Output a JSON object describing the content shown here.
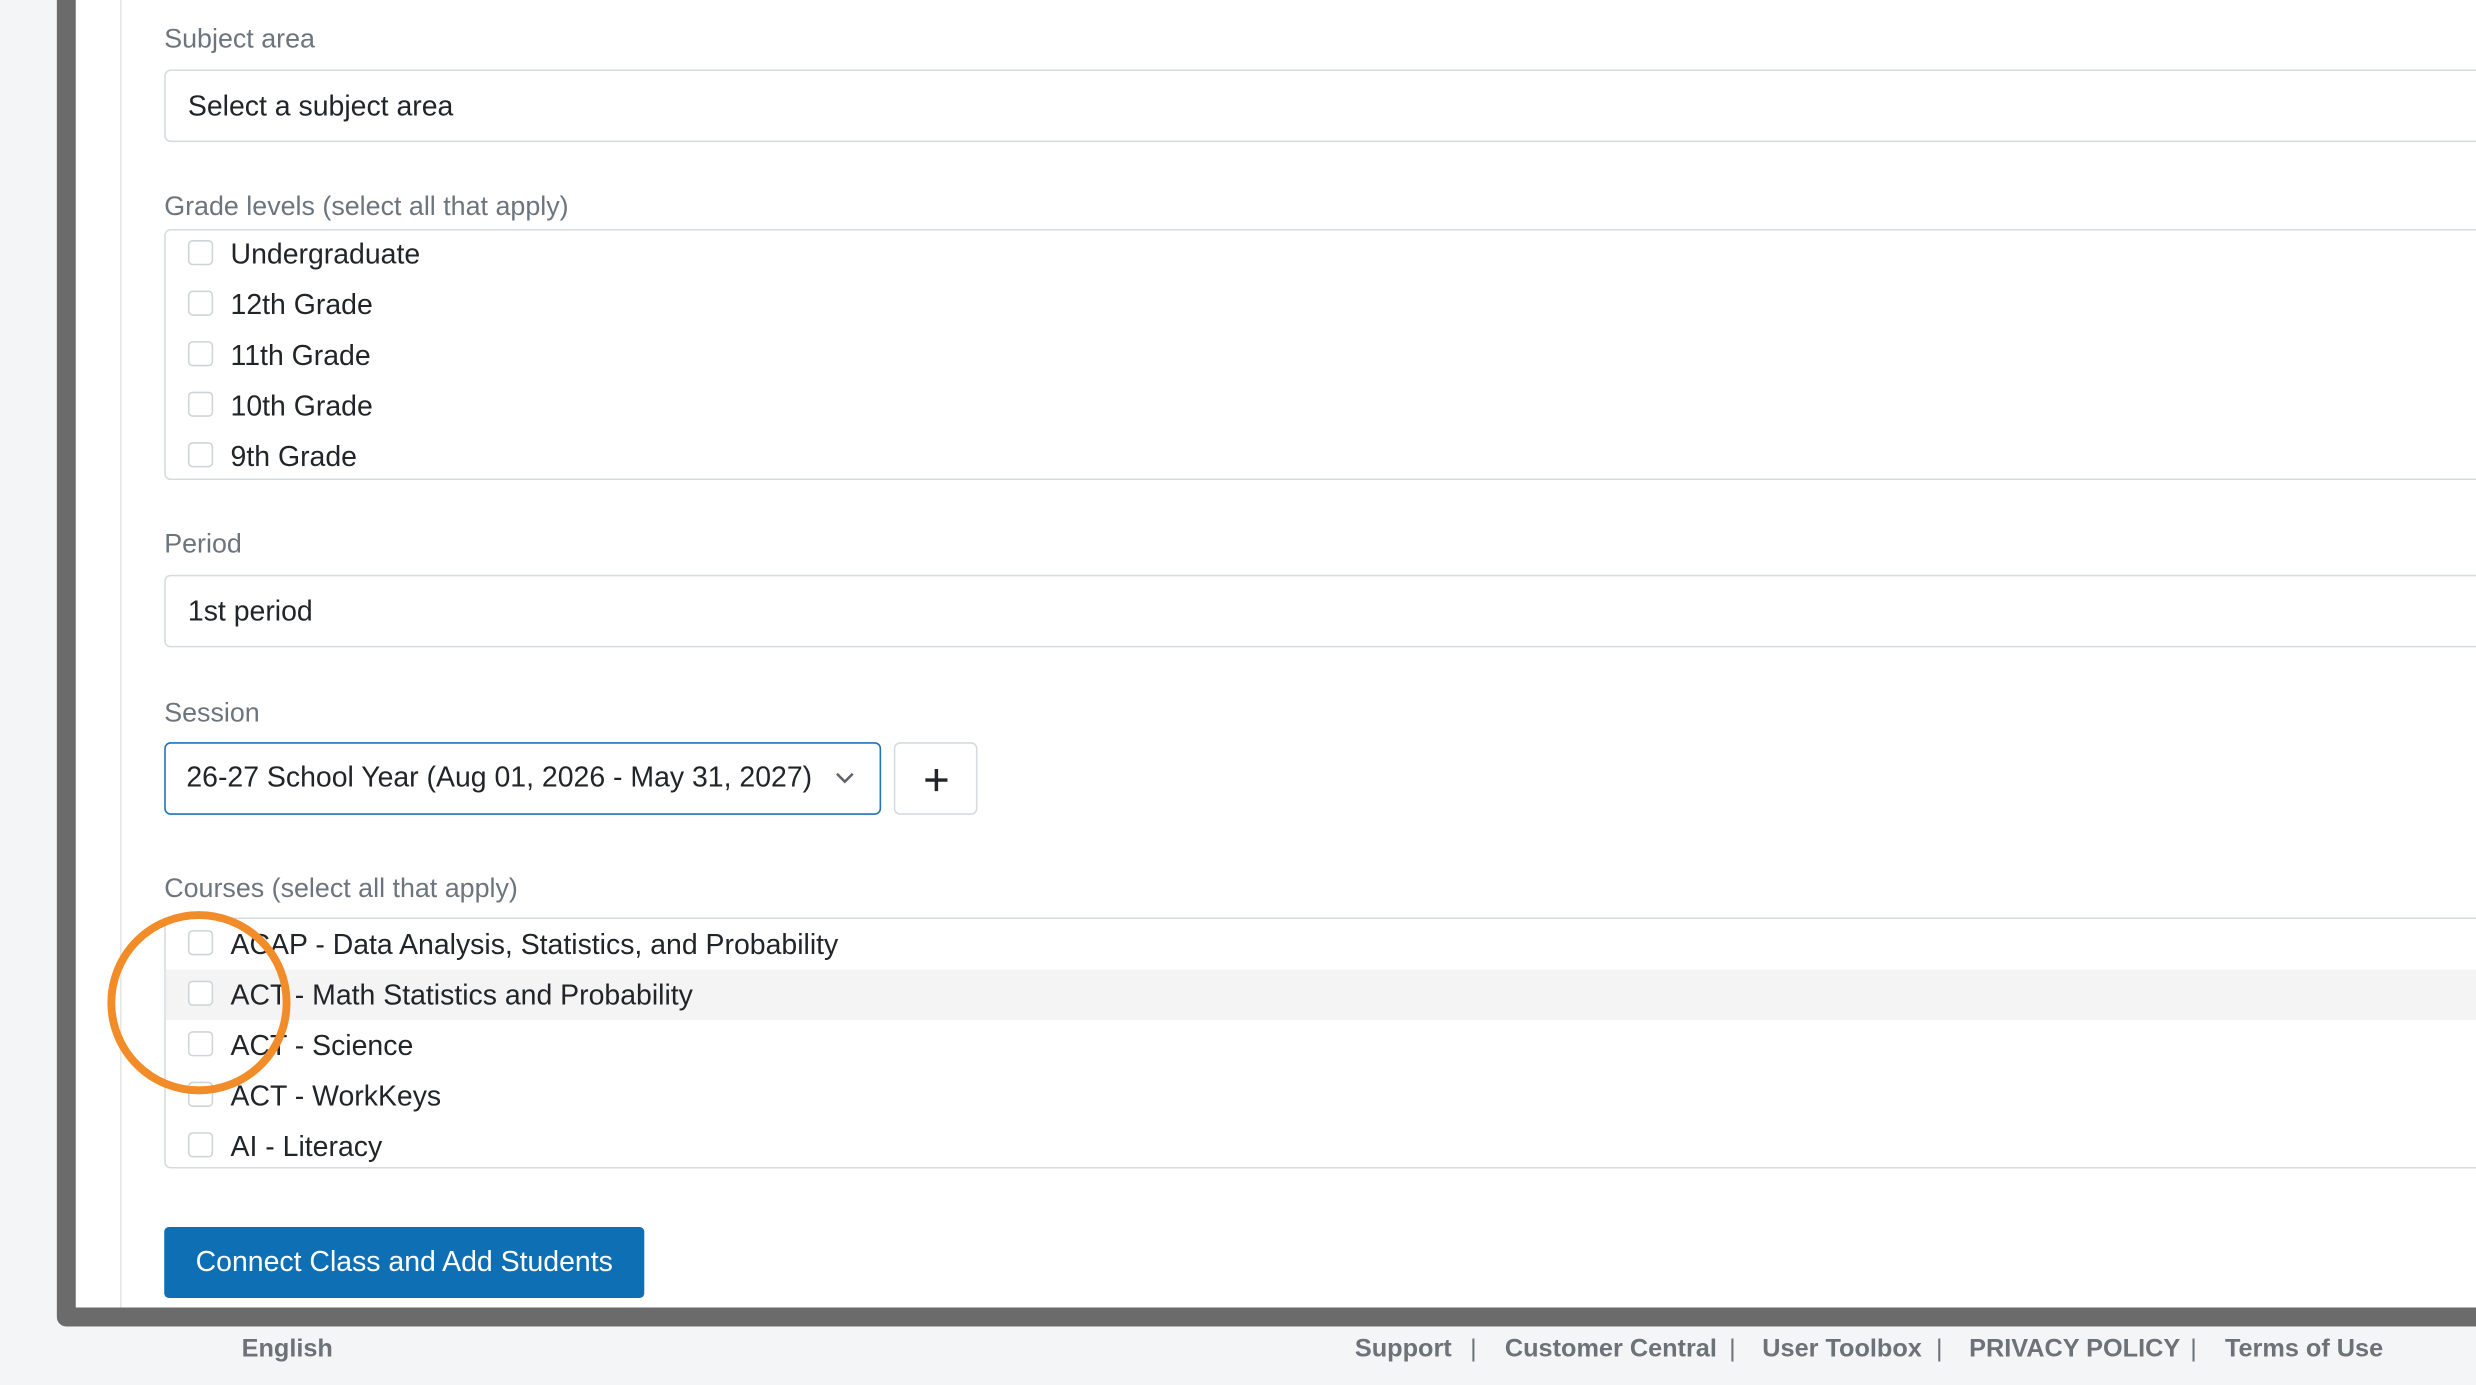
{
  "form": {
    "subject": {
      "label": "Subject area",
      "placeholder": "Select a subject area"
    },
    "grades": {
      "label": "Grade levels (select all that apply)",
      "options": [
        "Undergraduate",
        "12th Grade",
        "11th Grade",
        "10th Grade",
        "9th Grade"
      ]
    },
    "period": {
      "label": "Period",
      "value": "1st period"
    },
    "session": {
      "label": "Session",
      "value": "26-27 School Year (Aug 01, 2026 - May 31, 2027)"
    },
    "courses": {
      "label": "Courses (select all that apply)",
      "options": [
        "ACAP - Data Analysis, Statistics, and Probability",
        "ACT - Math Statistics and Probability",
        "ACT - Science",
        "ACT - WorkKeys",
        "AI - Literacy"
      ]
    },
    "submit_label": "Connect Class and Add Students"
  },
  "footer": {
    "language": "English",
    "links": [
      "Support",
      "Customer Central",
      "User Toolbox",
      "PRIVACY POLICY",
      "Terms of Use"
    ],
    "separator": "|"
  },
  "icons": {
    "session_dropdown": "chevron-down-icon",
    "add_session": "plus-icon"
  },
  "colors": {
    "primary": "#0e6fb5",
    "focus": "#1e73be",
    "highlight_ring": "#f28c28"
  }
}
